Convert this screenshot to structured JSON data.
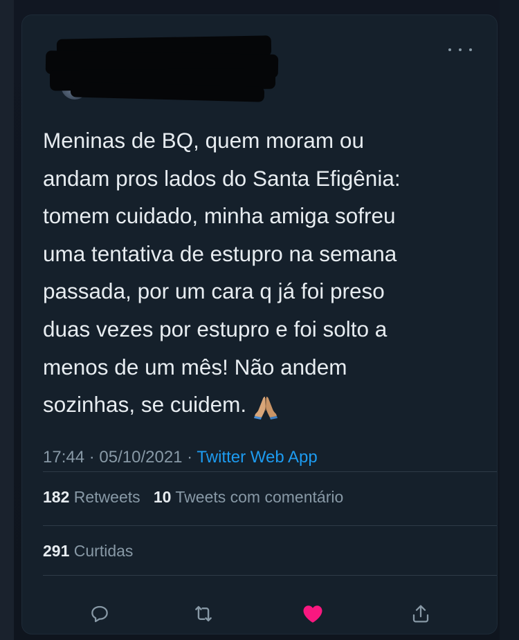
{
  "tweet": {
    "text": "Meninas de BQ, quem moram ou\nandam pros lados do Santa Efigênia:\ntomem cuidado, minha amiga sofreu\numa tentativa de estupro na semana\npassada, por um cara q já foi preso\nduas vezes por estupro e foi solto a\nmenos de um mês! Não andem\nsozinhas, se cuidem.",
    "emoji": "folded-hands-emoji",
    "time": "17:44",
    "separator": " · ",
    "date": "05/10/2021",
    "source": "Twitter Web App"
  },
  "stats": {
    "retweets_count": "182",
    "retweets_label": "Retweets",
    "quotes_count": "10",
    "quotes_label": "Tweets com comentário",
    "likes_count": "291",
    "likes_label": "Curtidas"
  },
  "colors": {
    "background": "#15202b",
    "text": "#e7ecf0",
    "muted": "#8899a6",
    "link": "#1d9bf0",
    "like": "#f91880"
  },
  "icons": {
    "more": "more-horizontal-icon",
    "reply": "reply-icon",
    "retweet": "retweet-icon",
    "like": "heart-filled-icon",
    "share": "share-icon"
  }
}
